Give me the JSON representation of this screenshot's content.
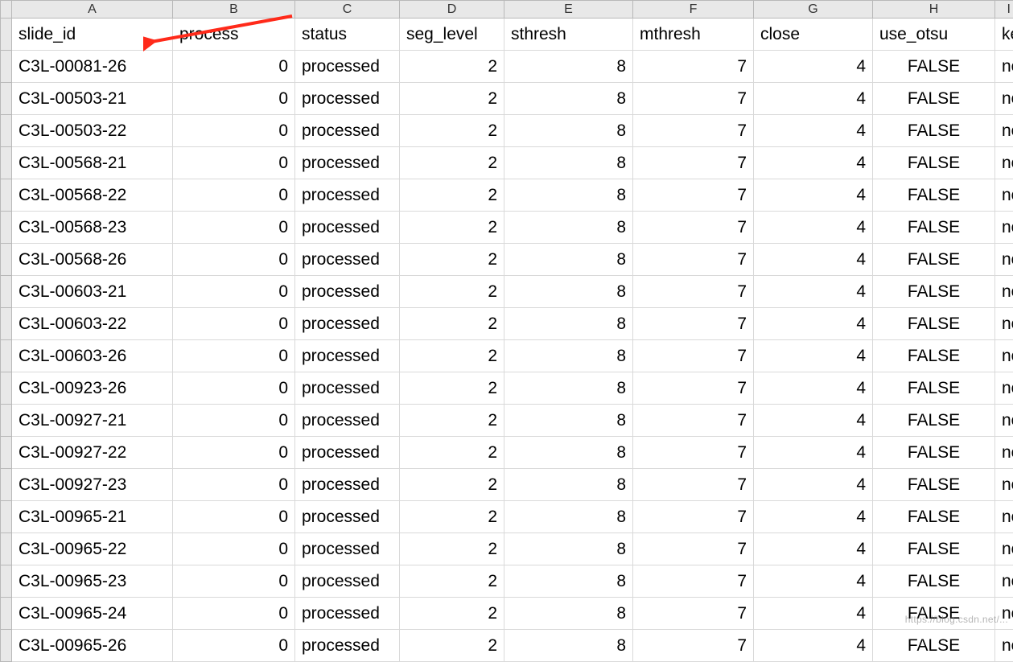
{
  "column_letters": [
    "A",
    "B",
    "C",
    "D",
    "E",
    "F",
    "G",
    "H",
    "I"
  ],
  "headers": {
    "A": "slide_id",
    "B": "process",
    "C": "status",
    "D": "seg_level",
    "E": "sthresh",
    "F": "mthresh",
    "G": "close",
    "H": "use_otsu",
    "I": "ke"
  },
  "rows": [
    {
      "A": "C3L-00081-26",
      "B": "0",
      "C": "processed",
      "D": "2",
      "E": "8",
      "F": "7",
      "G": "4",
      "H": "FALSE",
      "I": "no"
    },
    {
      "A": "C3L-00503-21",
      "B": "0",
      "C": "processed",
      "D": "2",
      "E": "8",
      "F": "7",
      "G": "4",
      "H": "FALSE",
      "I": "no"
    },
    {
      "A": "C3L-00503-22",
      "B": "0",
      "C": "processed",
      "D": "2",
      "E": "8",
      "F": "7",
      "G": "4",
      "H": "FALSE",
      "I": "no"
    },
    {
      "A": "C3L-00568-21",
      "B": "0",
      "C": "processed",
      "D": "2",
      "E": "8",
      "F": "7",
      "G": "4",
      "H": "FALSE",
      "I": "no"
    },
    {
      "A": "C3L-00568-22",
      "B": "0",
      "C": "processed",
      "D": "2",
      "E": "8",
      "F": "7",
      "G": "4",
      "H": "FALSE",
      "I": "no"
    },
    {
      "A": "C3L-00568-23",
      "B": "0",
      "C": "processed",
      "D": "2",
      "E": "8",
      "F": "7",
      "G": "4",
      "H": "FALSE",
      "I": "no"
    },
    {
      "A": "C3L-00568-26",
      "B": "0",
      "C": "processed",
      "D": "2",
      "E": "8",
      "F": "7",
      "G": "4",
      "H": "FALSE",
      "I": "no"
    },
    {
      "A": "C3L-00603-21",
      "B": "0",
      "C": "processed",
      "D": "2",
      "E": "8",
      "F": "7",
      "G": "4",
      "H": "FALSE",
      "I": "no"
    },
    {
      "A": "C3L-00603-22",
      "B": "0",
      "C": "processed",
      "D": "2",
      "E": "8",
      "F": "7",
      "G": "4",
      "H": "FALSE",
      "I": "no"
    },
    {
      "A": "C3L-00603-26",
      "B": "0",
      "C": "processed",
      "D": "2",
      "E": "8",
      "F": "7",
      "G": "4",
      "H": "FALSE",
      "I": "no"
    },
    {
      "A": "C3L-00923-26",
      "B": "0",
      "C": "processed",
      "D": "2",
      "E": "8",
      "F": "7",
      "G": "4",
      "H": "FALSE",
      "I": "no"
    },
    {
      "A": "C3L-00927-21",
      "B": "0",
      "C": "processed",
      "D": "2",
      "E": "8",
      "F": "7",
      "G": "4",
      "H": "FALSE",
      "I": "no"
    },
    {
      "A": "C3L-00927-22",
      "B": "0",
      "C": "processed",
      "D": "2",
      "E": "8",
      "F": "7",
      "G": "4",
      "H": "FALSE",
      "I": "no"
    },
    {
      "A": "C3L-00927-23",
      "B": "0",
      "C": "processed",
      "D": "2",
      "E": "8",
      "F": "7",
      "G": "4",
      "H": "FALSE",
      "I": "no"
    },
    {
      "A": "C3L-00965-21",
      "B": "0",
      "C": "processed",
      "D": "2",
      "E": "8",
      "F": "7",
      "G": "4",
      "H": "FALSE",
      "I": "no"
    },
    {
      "A": "C3L-00965-22",
      "B": "0",
      "C": "processed",
      "D": "2",
      "E": "8",
      "F": "7",
      "G": "4",
      "H": "FALSE",
      "I": "no"
    },
    {
      "A": "C3L-00965-23",
      "B": "0",
      "C": "processed",
      "D": "2",
      "E": "8",
      "F": "7",
      "G": "4",
      "H": "FALSE",
      "I": "no"
    },
    {
      "A": "C3L-00965-24",
      "B": "0",
      "C": "processed",
      "D": "2",
      "E": "8",
      "F": "7",
      "G": "4",
      "H": "FALSE",
      "I": "no"
    },
    {
      "A": "C3L-00965-26",
      "B": "0",
      "C": "processed",
      "D": "2",
      "E": "8",
      "F": "7",
      "G": "4",
      "H": "FALSE",
      "I": "no"
    }
  ],
  "alignment": {
    "A": "txt",
    "B": "num",
    "C": "txt",
    "D": "num",
    "E": "num",
    "F": "num",
    "G": "num",
    "H": "ctr",
    "I": "txt"
  },
  "annotation": {
    "arrow_color": "#ff2a1a"
  },
  "watermark": "https://blog.csdn.net/..."
}
